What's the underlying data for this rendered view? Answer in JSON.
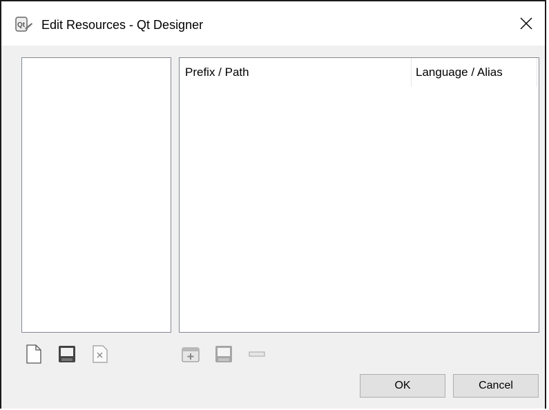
{
  "window": {
    "title": "Edit Resources - Qt Designer",
    "icon": "qt-designer-icon",
    "close_glyph": "✕"
  },
  "resource_tree": {
    "columns": [
      "Prefix / Path",
      "Language / Alias"
    ],
    "rows": []
  },
  "file_list": {
    "items": []
  },
  "file_toolbar": {
    "buttons": [
      "new-file-icon",
      "save-icon",
      "remove-file-icon"
    ]
  },
  "resource_toolbar": {
    "buttons": [
      "add-prefix-icon",
      "add-files-icon",
      "remove-icon"
    ]
  },
  "buttons": {
    "ok": "OK",
    "cancel": "Cancel"
  },
  "colors": {
    "frame": "#1a1a1a",
    "dialog_bg": "#f0f0f0",
    "button_bg": "#e1e1e1",
    "disabled_icon": "#a0a0a0"
  }
}
